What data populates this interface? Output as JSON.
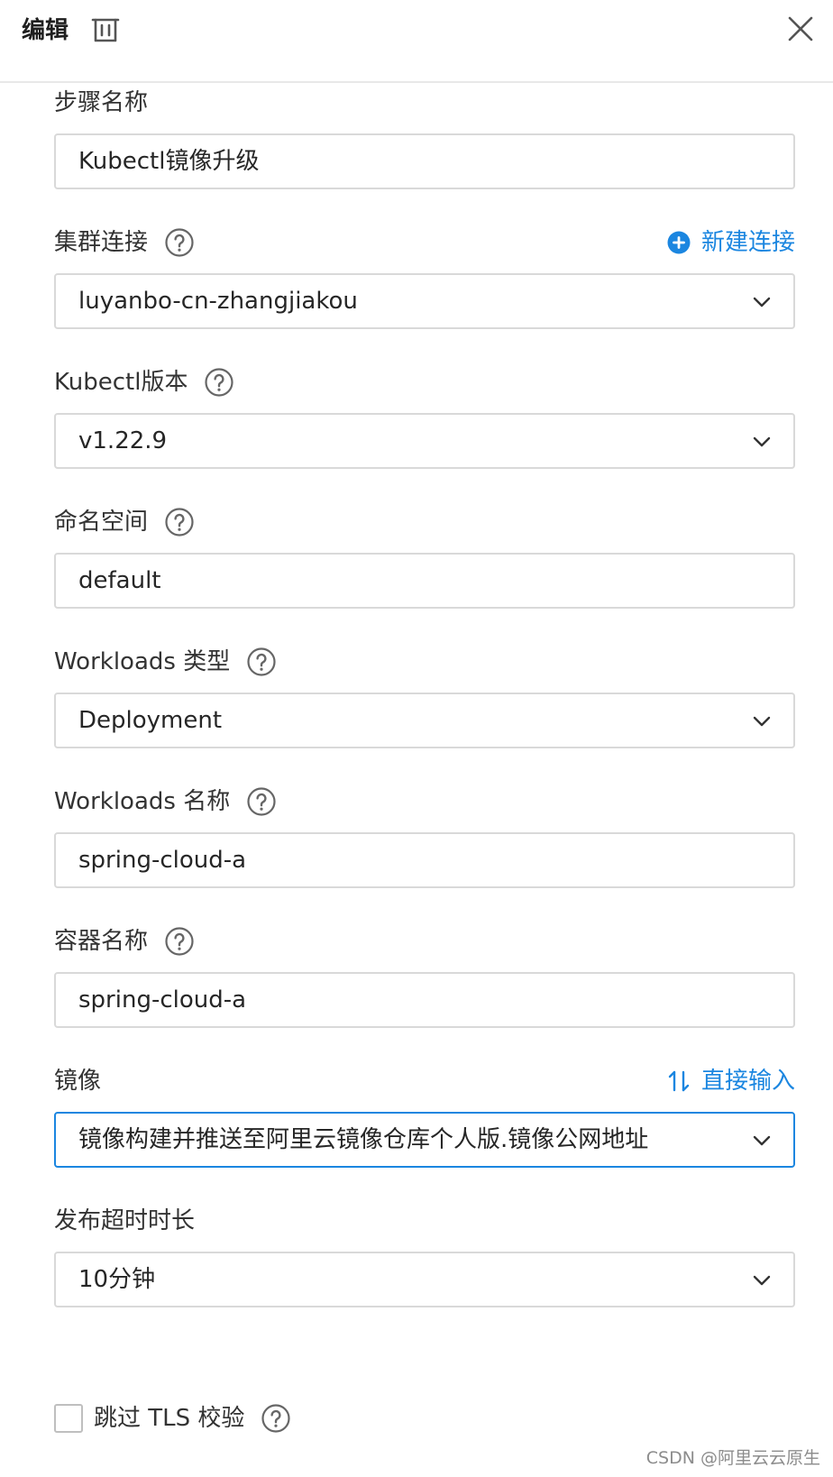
{
  "header": {
    "title": "编辑"
  },
  "fields": {
    "step_name": {
      "label": "步骤名称",
      "value": "Kubectl镜像升级"
    },
    "cluster": {
      "label": "集群连接",
      "value": "luyanbo-cn-zhangjiakou",
      "action": "新建连接"
    },
    "kubectl_version": {
      "label": "Kubectl版本",
      "value": "v1.22.9"
    },
    "namespace": {
      "label": "命名空间",
      "value": "default"
    },
    "workload_type": {
      "label": "Workloads 类型",
      "value": "Deployment"
    },
    "workload_name": {
      "label": "Workloads 名称",
      "value": "spring-cloud-a"
    },
    "container_name": {
      "label": "容器名称",
      "value": "spring-cloud-a"
    },
    "image": {
      "label": "镜像",
      "value": "镜像构建并推送至阿里云镜像仓库个人版.镜像公网地址",
      "action": "直接输入"
    },
    "timeout": {
      "label": "发布超时时长",
      "value": "10分钟"
    }
  },
  "skip_tls": {
    "label": "跳过 TLS 校验",
    "checked": false
  },
  "watermark": "CSDN @阿里云云原生",
  "colors": {
    "accent": "#1b86e0",
    "border": "#d9d9d9",
    "text": "#262626"
  }
}
